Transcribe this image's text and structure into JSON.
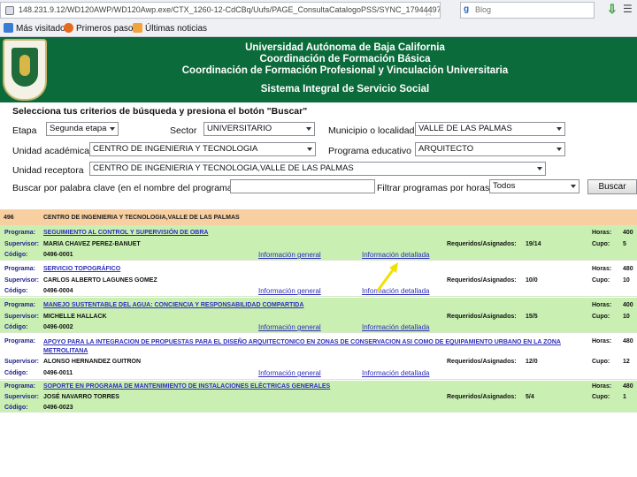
{
  "browser": {
    "url": "148.231.9.12/WD120AWP/WD120Awp.exe/CTX_1260-12-CdCBq/Uufs/PAGE_ConsultaCatalogoPSS/SYNC_17944497",
    "search_text": "Blog",
    "bookmarks": [
      "Más visitados",
      "Primeros pasos",
      "Últimas noticias"
    ]
  },
  "banner": {
    "lines": [
      "Universidad Autónoma de Baja California",
      "Coordinación de Formación Básica",
      "Coordinación de Formación Profesional y Vinculación Universitaria"
    ],
    "system": "Sistema Integral de Servicio Social"
  },
  "filters": {
    "title": "Selecciona tus criterios de búsqueda y presiona el botón \"Buscar\"",
    "etapa_label": "Etapa",
    "etapa_value": "Segunda etapa",
    "sector_label": "Sector",
    "sector_value": "UNIVERSITARIO",
    "municipio_label": "Municipio o localidad",
    "municipio_value": "VALLE DE LAS PALMAS",
    "unidad_label": "Unidad académica",
    "unidad_value": "CENTRO DE INGENIERIA Y TECNOLOGIA",
    "programa_label": "Programa educativo",
    "programa_value": "ARQUITECTO",
    "receptora_label": "Unidad receptora",
    "receptora_value": "CENTRO DE INGENIERIA Y TECNOLOGIA,VALLE DE LAS PALMAS",
    "keyword_label": "Buscar por palabra clave (en el nombre del programa)",
    "hours_label": "Filtrar programas por horas",
    "hours_value": "Todos",
    "search_button": "Buscar"
  },
  "results": {
    "unit_number": "496",
    "unit_name": "CENTRO DE INGENIERIA Y TECNOLOGIA,VALLE DE LAS PALMAS",
    "labels": {
      "programa": "Programa:",
      "supervisor": "Supervisor:",
      "codigo": "Código:",
      "horas": "Horas:",
      "cupo": "Cupo:",
      "req": "Requeridos/Asignados:",
      "info_general": "Información general",
      "info_detallada": "Información detallada"
    },
    "programs": [
      {
        "name": "SEGUIMIENTO AL CONTROL Y SUPERVISIÓN DE OBRA",
        "supervisor": "MARIA CHAVEZ PEREZ-BANUET",
        "code": "0496-0001",
        "hours": "400",
        "req": "19/14",
        "cupo": "5"
      },
      {
        "name": "SERVICIO TOPOGRÁFICO",
        "supervisor": "CARLOS ALBERTO LAGUNES GOMEZ",
        "code": "0496-0004",
        "hours": "480",
        "req": "10/0",
        "cupo": "10"
      },
      {
        "name": "MANEJO SUSTENTABLE DEL AGUA: CONCIENCIA Y RESPONSABILIDAD COMPARTIDA",
        "supervisor": "MICHELLE HALLACK",
        "code": "0496-0002",
        "hours": "400",
        "req": "15/5",
        "cupo": "10"
      },
      {
        "name": "APOYO PARA LA INTEGRACION DE PROPUESTAS PARA EL DISEÑO ARQUITECTONICO EN ZONAS DE CONSERVACION ASI COMO DE EQUIPAMIENTO URBANO EN LA ZONA METROLITANA",
        "supervisor": "ALONSO HERNANDEZ GUITRON",
        "code": "0496-0011",
        "hours": "480",
        "req": "12/0",
        "cupo": "12"
      },
      {
        "name": "SOPORTE EN PROGRAMA DE MANTENIMIENTO DE INSTALACIONES ELÉCTRICAS GENERALES",
        "supervisor": "JOSÉ NAVARRO TORRES",
        "code": "0496-0023",
        "hours": "480",
        "req": "5/4",
        "cupo": "1"
      }
    ]
  },
  "colors": {
    "banner": "#0b6b3a",
    "row_green": "#c9f0b2",
    "header_orange": "#f7cfa1",
    "link": "#2d2dba",
    "arrow": "#f2e000"
  }
}
